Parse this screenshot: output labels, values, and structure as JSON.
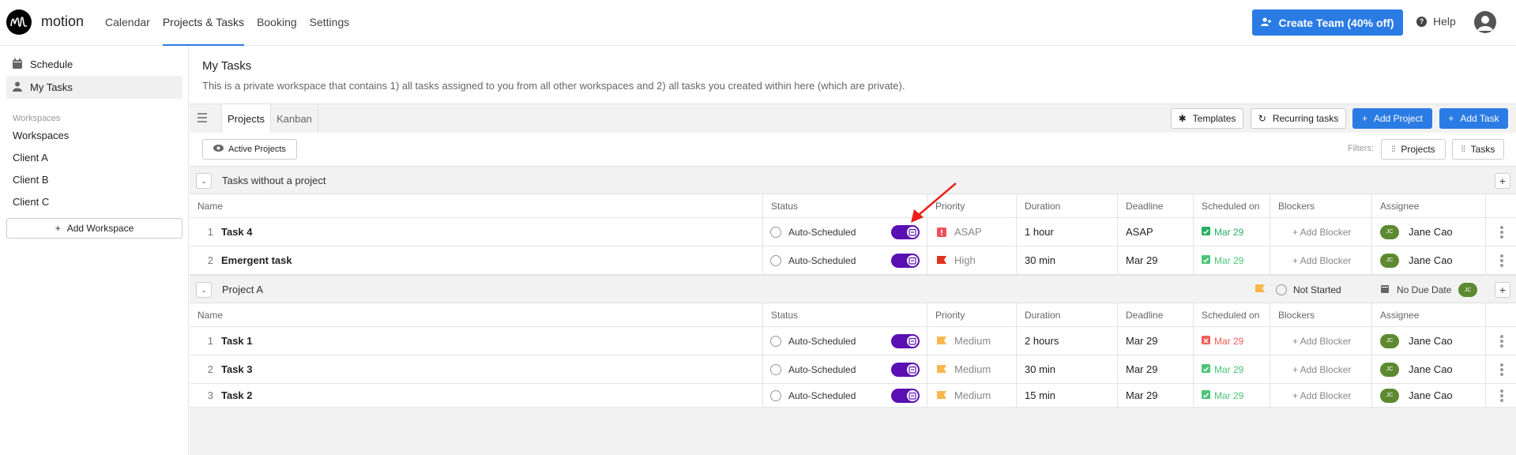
{
  "topbar": {
    "brand": "motion",
    "nav": [
      "Calendar",
      "Projects & Tasks",
      "Booking",
      "Settings"
    ],
    "active_nav": "Projects & Tasks",
    "cta_label": "Create Team (40% off)",
    "help_label": "Help",
    "accent": "#2b7be4"
  },
  "sidebar": {
    "items": [
      {
        "label": "Schedule",
        "icon": "calendar-icon"
      },
      {
        "label": "My Tasks",
        "icon": "person-icon",
        "active": true
      }
    ],
    "workspaces_label": "Workspaces",
    "workspaces": [
      "Workspaces",
      "Client A",
      "Client B",
      "Client C"
    ],
    "add_workspace": "Add Workspace"
  },
  "page": {
    "title": "My Tasks",
    "description": "This is a private workspace that contains 1) all tasks assigned to you from all other workspaces and 2) all tasks you created within here (which are private)."
  },
  "toolbar": {
    "tabs": [
      "Projects",
      "Kanban"
    ],
    "active_tab": "Projects",
    "templates": "Templates",
    "recurring": "Recurring tasks",
    "add_project": "Add Project",
    "add_task": "Add Task"
  },
  "filters": {
    "active_projects": "Active Projects",
    "label": "Filters:",
    "projects": "Projects",
    "tasks": "Tasks"
  },
  "columns": [
    "Name",
    "Status",
    "Priority",
    "Duration",
    "Deadline",
    "Scheduled on",
    "Blockers",
    "Assignee"
  ],
  "sections": [
    {
      "title": "Tasks without a project",
      "tasks": [
        {
          "index": "1",
          "name": "Task 4",
          "status": "Auto-Scheduled",
          "priority": "ASAP",
          "priority_icon": "alert-icon",
          "duration": "1 hour",
          "deadline": "ASAP",
          "scheduled": "Mar 29",
          "scheduled_state": "ok",
          "blocker": "+ Add Blocker",
          "assignee": "Jane Cao",
          "initials": "JC"
        },
        {
          "index": "2",
          "name": "Emergent task",
          "status": "Auto-Scheduled",
          "priority": "High",
          "priority_icon": "flag-icon",
          "duration": "30 min",
          "deadline": "Mar 29",
          "scheduled": "Mar 29",
          "scheduled_state": "ok",
          "blocker": "+ Add Blocker",
          "assignee": "Jane Cao",
          "initials": "JC"
        }
      ]
    },
    {
      "title": "Project A",
      "meta": {
        "status": "Not Started",
        "due": "No Due Date",
        "initials": "JC"
      },
      "tasks": [
        {
          "index": "1",
          "name": "Task 1",
          "status": "Auto-Scheduled",
          "priority": "Medium",
          "priority_icon": "flag-icon",
          "duration": "2 hours",
          "deadline": "Mar 29",
          "scheduled": "Mar 29",
          "scheduled_state": "late",
          "blocker": "+ Add Blocker",
          "assignee": "Jane Cao",
          "initials": "JC"
        },
        {
          "index": "2",
          "name": "Task 3",
          "status": "Auto-Scheduled",
          "priority": "Medium",
          "priority_icon": "flag-icon",
          "duration": "30 min",
          "deadline": "Mar 29",
          "scheduled": "Mar 29",
          "scheduled_state": "ok",
          "blocker": "+ Add Blocker",
          "assignee": "Jane Cao",
          "initials": "JC"
        },
        {
          "index": "3",
          "name": "Task 2",
          "status": "Auto-Scheduled",
          "priority": "Medium",
          "priority_icon": "flag-icon",
          "duration": "15 min",
          "deadline": "Mar 29",
          "scheduled": "Mar 29",
          "scheduled_state": "ok",
          "blocker": "+ Add Blocker",
          "assignee": "Jane Cao",
          "initials": "JC"
        }
      ]
    }
  ],
  "colors": {
    "toggle": "#5a0fb2",
    "asap": "#f0505a",
    "high": "#e0321e",
    "medium": "#f8b84e",
    "scheduled_ok": "#27ae60",
    "scheduled_ok_light": "#4cc477",
    "scheduled_late": "#f0605a",
    "assignee": "#5d8a30"
  }
}
